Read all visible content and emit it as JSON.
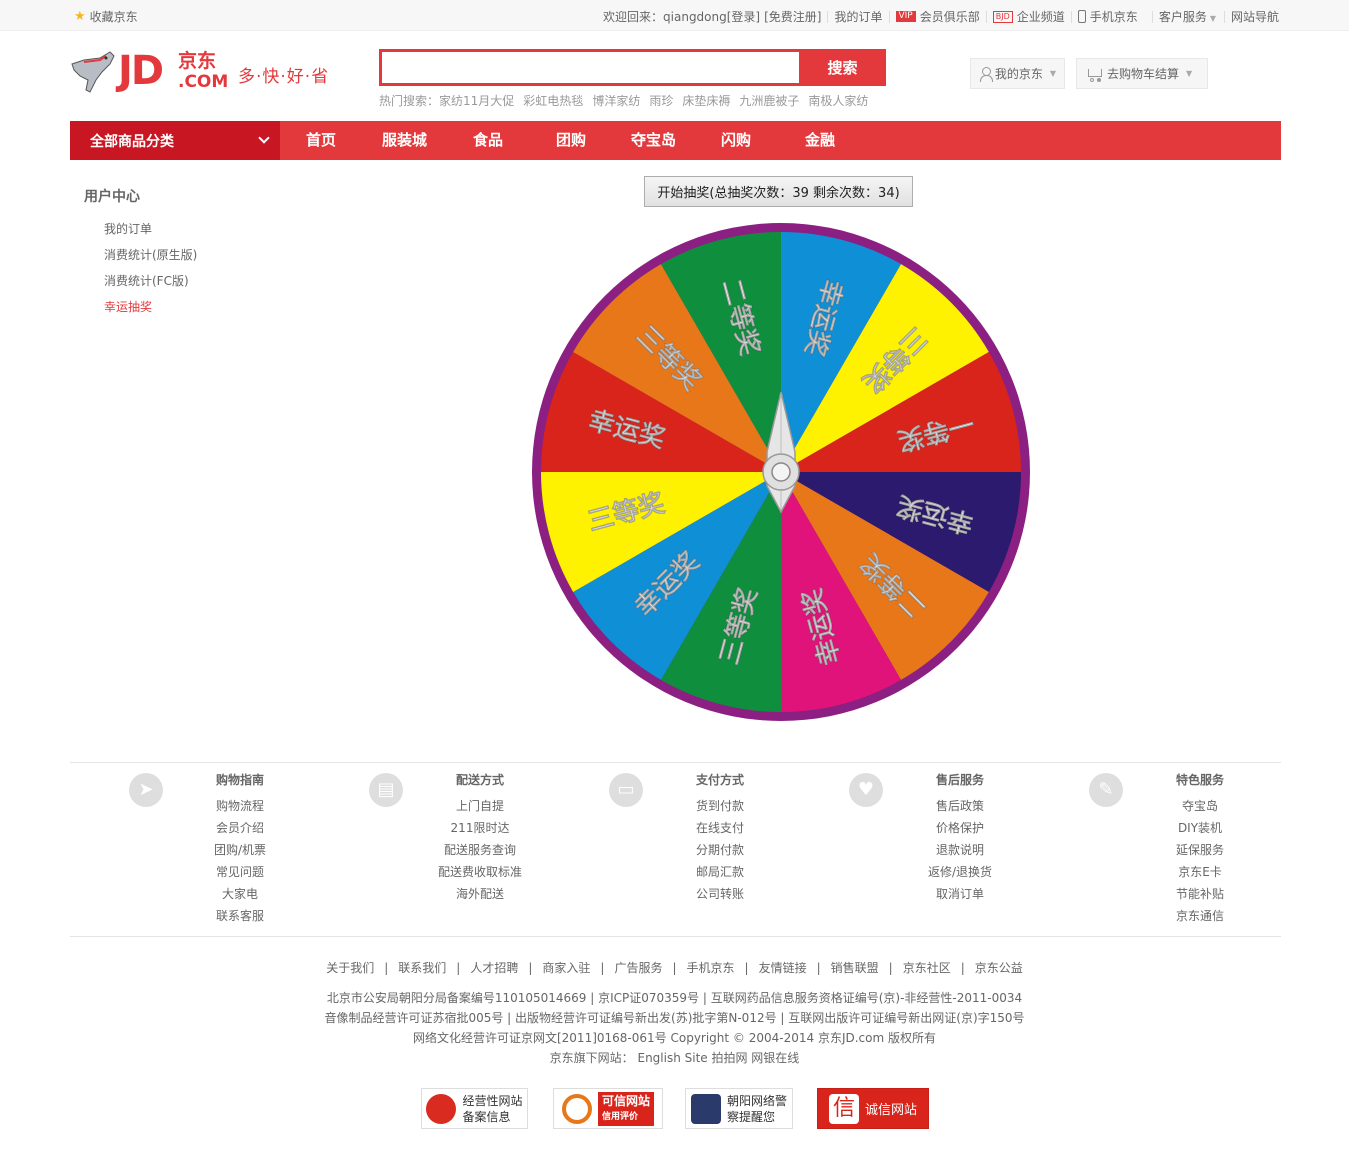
{
  "topbar": {
    "favorite": "收藏京东",
    "welcome": "欢迎回来：qiangdong[登录]",
    "register": "[免费注册]",
    "my_orders": "我的订单",
    "vip_badge": "VIP",
    "vip_club": "会员俱乐部",
    "bjd_badge": "BJD",
    "enterprise": "企业频道",
    "mobile": "手机京东",
    "customer_service": "客户服务",
    "site_nav": "网站导航"
  },
  "header": {
    "logo_jd": "JD",
    "logo_cn": "京东",
    "logo_com": ".COM",
    "slogan": "多·快·好·省",
    "search_placeholder": "",
    "search_button": "搜索",
    "hot_label": "热门搜索：",
    "hot_words": [
      "家纺11月大促",
      "彩虹电热毯",
      "博洋家纺",
      "雨珍",
      "床垫床褥",
      "九洲鹿被子",
      "南极人家纺"
    ],
    "my_jd": "我的京东",
    "cart": "去购物车结算"
  },
  "nav": {
    "all_categories": "全部商品分类",
    "items": [
      "首页",
      "服装城",
      "食品",
      "团购",
      "夺宝岛",
      "闪购",
      "金融"
    ]
  },
  "sidebar": {
    "title": "用户中心",
    "links": [
      "我的订单",
      "消费统计(原生版)",
      "消费统计(FC版)",
      "幸运抽奖"
    ],
    "active_index": 3
  },
  "lottery": {
    "start_button": "开始抽奖(总抽奖次数：39 剩余次数：34)",
    "ring_color": "#8b1f82",
    "segments": [
      {
        "label": "幸运奖",
        "color": "#0f8fd6"
      },
      {
        "label": "三等奖",
        "color": "#fff200"
      },
      {
        "label": "一等奖",
        "color": "#d9241c"
      },
      {
        "label": "幸运奖",
        "color": "#2b1a6e"
      },
      {
        "label": "二等奖",
        "color": "#e8771a"
      },
      {
        "label": "幸运奖",
        "color": "#e0137a"
      },
      {
        "label": "三等奖",
        "color": "#0f8f3e"
      },
      {
        "label": "幸运奖",
        "color": "#0f8fd6"
      },
      {
        "label": "三等奖",
        "color": "#fff200"
      },
      {
        "label": "幸运奖",
        "color": "#d9241c"
      },
      {
        "label": "三等奖",
        "color": "#e8771a"
      },
      {
        "label": "二等奖",
        "color": "#0f8f3e"
      }
    ]
  },
  "footer": {
    "columns": [
      {
        "title": "购物指南",
        "icon": "compass-icon",
        "links": [
          "购物流程",
          "会员介绍",
          "团购/机票",
          "常见问题",
          "大家电",
          "联系客服"
        ]
      },
      {
        "title": "配送方式",
        "icon": "bus-icon",
        "links": [
          "上门自提",
          "211限时达",
          "配送服务查询",
          "配送费收取标准",
          "海外配送"
        ]
      },
      {
        "title": "支付方式",
        "icon": "wallet-icon",
        "links": [
          "货到付款",
          "在线支付",
          "分期付款",
          "邮局汇款",
          "公司转账"
        ]
      },
      {
        "title": "售后服务",
        "icon": "heart-icon",
        "links": [
          "售后政策",
          "价格保护",
          "退款说明",
          "返修/退换货",
          "取消订单"
        ]
      },
      {
        "title": "特色服务",
        "icon": "wrench-icon",
        "links": [
          "夺宝岛",
          "DIY装机",
          "延保服务",
          "京东E卡",
          "节能补贴",
          "京东通信"
        ]
      }
    ],
    "links": [
      "关于我们",
      "联系我们",
      "人才招聘",
      "商家入驻",
      "广告服务",
      "手机京东",
      "友情链接",
      "销售联盟",
      "京东社区",
      "京东公益"
    ],
    "copy": [
      "北京市公安局朝阳分局备案编号110105014669 | 京ICP证070359号 | 互联网药品信息服务资格证编号(京)-非经营性-2011-0034",
      "音像制品经营许可证苏宿批005号 | 出版物经营许可证编号新出发(苏)批字第N-012号 | 互联网出版许可证编号新出网证(京)字150号",
      "网络文化经营许可证京网文[2011]0168-061号 Copyright © 2004-2014 京东JD.com 版权所有",
      "京东旗下网站： English Site 拍拍网 网银在线"
    ],
    "certs": [
      {
        "line1": "经营性网站",
        "line2": "备案信息"
      },
      {
        "line1": "可信网站",
        "line2": "信用评价"
      },
      {
        "line1": "朝阳网络警",
        "line2": "察提醒您"
      },
      {
        "line1": "诚信网站",
        "line2": ""
      }
    ]
  }
}
